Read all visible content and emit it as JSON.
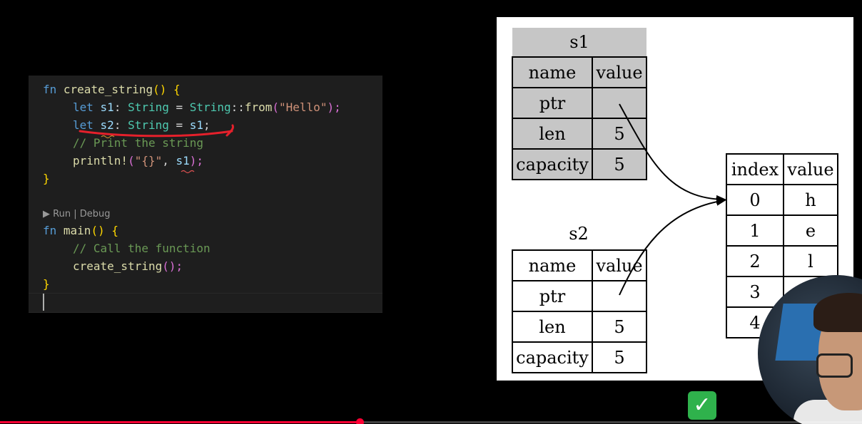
{
  "editor": {
    "lines": {
      "l1": {
        "kw": "fn",
        "name": "create_string",
        "rest": "() {"
      },
      "l2": {
        "kw": "let",
        "var": "s1",
        "colon": ": ",
        "type": "String",
        "eq": " = ",
        "type2": "String",
        "sep": "::",
        "call": "from",
        "open": "(",
        "arg": "\"Hello\"",
        "close": ");"
      },
      "l3": {
        "kw": "let",
        "var": "s2",
        "colon": ": ",
        "type": "String",
        "eq": " = ",
        "val": "s1",
        "end": ";"
      },
      "l4": {
        "comment": "// Print the string"
      },
      "l5": {
        "macro": "println!",
        "open": "(",
        "arg": "\"{}\"",
        "comma": ", ",
        "var": "s1",
        "close": ");"
      },
      "l6": {
        "brace": "}"
      },
      "l8": {
        "kw": "fn",
        "name": "main",
        "rest": "() {"
      },
      "l9": {
        "comment": "// Call the function"
      },
      "l10": {
        "call": "create_string",
        "rest": "();"
      },
      "l11": {
        "brace": "}"
      }
    },
    "codelens": "▶ Run | Debug",
    "annotation_color": "#e5202b"
  },
  "diagram": {
    "s1": {
      "title": "s1",
      "header": [
        "name",
        "value"
      ],
      "rows": [
        {
          "name": "ptr",
          "value": ""
        },
        {
          "name": "len",
          "value": "5"
        },
        {
          "name": "capacity",
          "value": "5"
        }
      ]
    },
    "s2": {
      "title": "s2",
      "header": [
        "name",
        "value"
      ],
      "rows": [
        {
          "name": "ptr",
          "value": ""
        },
        {
          "name": "len",
          "value": "5"
        },
        {
          "name": "capacity",
          "value": "5"
        }
      ]
    },
    "heap": {
      "header": [
        "index",
        "value"
      ],
      "rows": [
        {
          "index": "0",
          "value": "h"
        },
        {
          "index": "1",
          "value": "e"
        },
        {
          "index": "2",
          "value": "l"
        },
        {
          "index": "3",
          "value": ""
        },
        {
          "index": "4",
          "value": ""
        }
      ]
    }
  },
  "badge": {
    "symbol": "✓",
    "color": "#2fb24c"
  },
  "video": {
    "progress_fraction": 0.417,
    "accent": "#ff0033"
  }
}
